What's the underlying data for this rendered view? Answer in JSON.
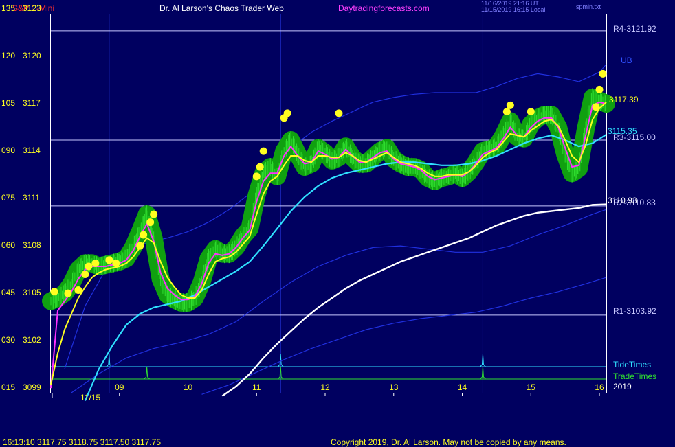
{
  "header": {
    "instrument": "S&P E-Mini",
    "site_title": "Dr. Al Larson's Chaos Trader Web",
    "website": "Daytradingforecasts.com",
    "stamp_utc": "11/16/2019 21:16 UT",
    "stamp_local": "11/15/2019 16:15 Local",
    "file_name": "spmin.txt"
  },
  "footer": {
    "quote": "16:13:10  3117.75  3118.75  3117.50  3117.75",
    "copyright": "Copyright 2019, Dr. Al Larson. May not be copied by any means."
  },
  "colors": {
    "background": "#000060",
    "price_halo": "#10a010",
    "price_bars": "#30e030",
    "magenta": "#ff30ff",
    "yellow": "#ffff20",
    "cyan": "#30e0ff",
    "white": "#ffffff",
    "blue_band": "#2030e0",
    "pivot_line": "#c8c8ff"
  },
  "chart_data": {
    "type": "line",
    "instrument": "S&P E-Mini",
    "y_axis_left_labels": [
      {
        "osc": "135",
        "price": "3123"
      },
      {
        "osc": "120",
        "price": "3120"
      },
      {
        "osc": "105",
        "price": "3117"
      },
      {
        "osc": "090",
        "price": "3114"
      },
      {
        "osc": "075",
        "price": "3111"
      },
      {
        "osc": "060",
        "price": "3108"
      },
      {
        "osc": "045",
        "price": "3105"
      },
      {
        "osc": "030",
        "price": "3102"
      },
      {
        "osc": "015",
        "price": "3099"
      }
    ],
    "ylim": [
      3099,
      3123
    ],
    "xlim": [
      8.0,
      16.1
    ],
    "x_ticks": [
      "09",
      "10",
      "11",
      "12",
      "13",
      "14",
      "15",
      "16"
    ],
    "x_tick_values": [
      9,
      10,
      11,
      12,
      13,
      14,
      15,
      16
    ],
    "date_label": "11/15",
    "year_label": "2019",
    "pivot_levels": [
      {
        "label": "R4-3121.92",
        "value": 3121.92
      },
      {
        "label": "R3-3115.00",
        "value": 3115.0
      },
      {
        "label": "R2-3110.83",
        "value": 3110.83
      },
      {
        "label": "R1-3103.92",
        "value": 3103.92
      }
    ],
    "value_labels": [
      {
        "label": "3117.39",
        "value": 3117.39,
        "color": "#ffff20"
      },
      {
        "label": "3115.35",
        "value": 3115.35,
        "color": "#30e0ff"
      },
      {
        "label": "3110.93",
        "value": 3110.93,
        "color": "#ffffff"
      }
    ],
    "band_label": "UB",
    "timing_lines": [
      {
        "name": "TideTimes",
        "spikes": [
          8.85,
          11.35,
          14.3
        ]
      },
      {
        "name": "TradeTimes",
        "spikes": [
          9.4,
          11.35,
          14.3
        ]
      }
    ],
    "vertical_markers": [
      8.85,
      11.35,
      14.3
    ],
    "series": [
      {
        "name": "price",
        "color": "#30e030",
        "x": [
          8.0,
          8.1,
          8.2,
          8.3,
          8.4,
          8.5,
          8.6,
          8.7,
          8.8,
          8.9,
          9.0,
          9.1,
          9.2,
          9.3,
          9.4,
          9.5,
          9.6,
          9.7,
          9.8,
          9.9,
          10.0,
          10.1,
          10.2,
          10.3,
          10.4,
          10.5,
          10.6,
          10.7,
          10.8,
          10.9,
          11.0,
          11.1,
          11.2,
          11.3,
          11.4,
          11.5,
          11.6,
          11.7,
          11.8,
          11.9,
          12.0,
          12.1,
          12.2,
          12.3,
          12.4,
          12.5,
          12.6,
          12.7,
          12.8,
          12.9,
          13.0,
          13.1,
          13.2,
          13.3,
          13.4,
          13.5,
          13.6,
          13.7,
          13.8,
          13.9,
          14.0,
          14.1,
          14.2,
          14.3,
          14.4,
          14.5,
          14.6,
          14.7,
          14.8,
          14.9,
          15.0,
          15.1,
          15.2,
          15.3,
          15.4,
          15.5,
          15.6,
          15.7,
          15.8,
          15.9,
          16.0,
          16.1
        ],
        "y": [
          3104.8,
          3105.0,
          3105.3,
          3105.9,
          3106.8,
          3107.2,
          3107.2,
          3107.0,
          3107.1,
          3107.2,
          3107.3,
          3107.5,
          3108.2,
          3109.2,
          3110.3,
          3108.8,
          3106.2,
          3105.2,
          3104.9,
          3104.7,
          3104.7,
          3105.0,
          3106.0,
          3107.5,
          3108.1,
          3107.8,
          3107.8,
          3108.2,
          3108.9,
          3109.4,
          3111.5,
          3112.9,
          3113.3,
          3112.7,
          3114.3,
          3115.0,
          3114.1,
          3113.3,
          3113.5,
          3114.5,
          3114.2,
          3113.7,
          3113.9,
          3114.6,
          3113.9,
          3113.5,
          3113.5,
          3113.9,
          3114.3,
          3114.5,
          3113.8,
          3113.5,
          3113.3,
          3113.3,
          3113.1,
          3112.6,
          3112.4,
          3112.6,
          3112.7,
          3112.9,
          3112.6,
          3113.0,
          3113.6,
          3114.3,
          3114.4,
          3114.6,
          3115.3,
          3116.2,
          3115.2,
          3115.1,
          3116.0,
          3116.4,
          3116.6,
          3116.6,
          3115.8,
          3114.1,
          3112.9,
          3113.2,
          3115.7,
          3117.7,
          3117.5,
          3117.3
        ]
      },
      {
        "name": "magenta",
        "color": "#ff30ff",
        "x": [
          8.0,
          8.1,
          8.2,
          8.3,
          8.4,
          8.5,
          8.6,
          8.7,
          8.8,
          8.9,
          9.0,
          9.1,
          9.2,
          9.3,
          9.4,
          9.5,
          9.6,
          9.7,
          9.8,
          9.9,
          10.0,
          10.1,
          10.2,
          10.3,
          10.4,
          10.5,
          10.6,
          10.7,
          10.8,
          10.9,
          11.0,
          11.1,
          11.2,
          11.3,
          11.4,
          11.5,
          11.6,
          11.7,
          11.8,
          11.9,
          12.0,
          12.1,
          12.2,
          12.3,
          12.4,
          12.5,
          12.6,
          12.7,
          12.8,
          12.9,
          13.0,
          13.1,
          13.2,
          13.3,
          13.4,
          13.5,
          13.6,
          13.7,
          13.8,
          13.9,
          14.0,
          14.1,
          14.2,
          14.3,
          14.4,
          14.5,
          14.6,
          14.7,
          14.8,
          14.9,
          15.0,
          15.1,
          15.2,
          15.3,
          15.4,
          15.5,
          15.6,
          15.7,
          15.8,
          15.9,
          16.0,
          16.1
        ],
        "y": [
          3099.3,
          3104.2,
          3104.8,
          3105.4,
          3106.2,
          3106.8,
          3107.0,
          3107.0,
          3107.0,
          3107.1,
          3107.2,
          3107.4,
          3108.0,
          3108.9,
          3109.7,
          3108.6,
          3106.6,
          3105.6,
          3105.2,
          3104.9,
          3104.9,
          3105.1,
          3105.9,
          3107.2,
          3107.8,
          3107.7,
          3107.8,
          3108.2,
          3108.8,
          3109.3,
          3111.1,
          3112.4,
          3112.9,
          3112.9,
          3114.0,
          3114.6,
          3114.0,
          3113.5,
          3113.6,
          3114.3,
          3114.1,
          3113.8,
          3113.9,
          3114.4,
          3114.0,
          3113.6,
          3113.6,
          3113.9,
          3114.2,
          3114.3,
          3113.8,
          3113.5,
          3113.4,
          3113.3,
          3113.1,
          3112.7,
          3112.5,
          3112.6,
          3112.7,
          3112.8,
          3112.7,
          3113.0,
          3113.5,
          3114.1,
          3114.3,
          3114.5,
          3115.1,
          3115.8,
          3115.3,
          3115.2,
          3115.8,
          3116.2,
          3116.4,
          3116.4,
          3115.8,
          3114.5,
          3113.3,
          3113.4,
          3115.3,
          3117.2,
          3117.4,
          3117.3
        ]
      },
      {
        "name": "yellow",
        "color": "#ffff20",
        "x": [
          8.0,
          8.1,
          8.2,
          8.3,
          8.4,
          8.5,
          8.6,
          8.7,
          8.8,
          8.9,
          9.0,
          9.1,
          9.2,
          9.3,
          9.4,
          9.5,
          9.6,
          9.7,
          9.8,
          9.9,
          10.0,
          10.1,
          10.2,
          10.3,
          10.4,
          10.5,
          10.6,
          10.7,
          10.8,
          10.9,
          11.0,
          11.1,
          11.2,
          11.3,
          11.4,
          11.5,
          11.6,
          11.7,
          11.8,
          11.9,
          12.0,
          12.1,
          12.2,
          12.3,
          12.4,
          12.5,
          12.6,
          12.7,
          12.8,
          12.9,
          13.0,
          13.1,
          13.2,
          13.3,
          13.4,
          13.5,
          13.6,
          13.7,
          13.8,
          13.9,
          14.0,
          14.1,
          14.2,
          14.3,
          14.4,
          14.5,
          14.6,
          14.7,
          14.8,
          14.9,
          15.0,
          15.1,
          15.2,
          15.3,
          15.4,
          15.5,
          15.6,
          15.7,
          15.8,
          15.9,
          16.0,
          16.1
        ],
        "y": [
          3099.5,
          3101.5,
          3103.0,
          3104.0,
          3105.0,
          3105.7,
          3106.3,
          3106.6,
          3106.8,
          3106.9,
          3107.0,
          3107.2,
          3107.6,
          3108.2,
          3108.8,
          3108.5,
          3107.3,
          3106.3,
          3105.7,
          3105.2,
          3105.0,
          3105.0,
          3105.5,
          3106.5,
          3107.3,
          3107.5,
          3107.6,
          3107.9,
          3108.4,
          3108.9,
          3110.3,
          3111.6,
          3112.4,
          3112.7,
          3113.4,
          3114.0,
          3114.0,
          3113.7,
          3113.6,
          3114.0,
          3114.0,
          3113.9,
          3113.9,
          3114.2,
          3114.0,
          3113.7,
          3113.6,
          3113.8,
          3114.0,
          3114.2,
          3113.9,
          3113.6,
          3113.5,
          3113.4,
          3113.2,
          3112.9,
          3112.7,
          3112.7,
          3112.8,
          3112.8,
          3112.8,
          3113.0,
          3113.4,
          3113.9,
          3114.2,
          3114.4,
          3114.9,
          3115.4,
          3115.3,
          3115.2,
          3115.6,
          3115.9,
          3116.2,
          3116.3,
          3115.9,
          3115.0,
          3114.0,
          3113.6,
          3114.7,
          3116.3,
          3117.0,
          3117.4
        ]
      },
      {
        "name": "cyan",
        "color": "#30e0ff",
        "x": [
          8.5,
          8.7,
          8.9,
          9.1,
          9.3,
          9.5,
          9.7,
          9.9,
          10.1,
          10.3,
          10.5,
          10.7,
          10.9,
          11.1,
          11.3,
          11.5,
          11.7,
          11.9,
          12.1,
          12.3,
          12.5,
          12.7,
          12.9,
          13.1,
          13.3,
          13.5,
          13.7,
          13.9,
          14.1,
          14.3,
          14.5,
          14.7,
          14.9,
          15.1,
          15.3,
          15.5,
          15.7,
          15.9,
          16.1
        ],
        "y": [
          3098.5,
          3100.5,
          3102.0,
          3103.3,
          3104.0,
          3104.4,
          3104.6,
          3104.8,
          3105.2,
          3105.7,
          3106.2,
          3106.7,
          3107.3,
          3108.3,
          3109.4,
          3110.5,
          3111.4,
          3112.1,
          3112.6,
          3112.9,
          3113.1,
          3113.3,
          3113.5,
          3113.6,
          3113.6,
          3113.5,
          3113.4,
          3113.4,
          3113.5,
          3113.7,
          3114.0,
          3114.4,
          3114.8,
          3115.1,
          3115.3,
          3115.0,
          3114.6,
          3114.8,
          3115.35
        ]
      },
      {
        "name": "white",
        "color": "#ffffff",
        "x": [
          10.5,
          10.7,
          10.9,
          11.1,
          11.3,
          11.5,
          11.7,
          11.9,
          12.1,
          12.3,
          12.5,
          12.7,
          12.9,
          13.1,
          13.3,
          13.5,
          13.7,
          13.9,
          14.1,
          14.3,
          14.5,
          14.7,
          14.9,
          15.1,
          15.3,
          15.5,
          15.7,
          15.9,
          16.1
        ],
        "y": [
          3098.8,
          3099.4,
          3100.2,
          3101.2,
          3102.1,
          3102.9,
          3103.7,
          3104.4,
          3105.0,
          3105.6,
          3106.1,
          3106.5,
          3106.9,
          3107.3,
          3107.6,
          3107.9,
          3108.2,
          3108.5,
          3108.8,
          3109.2,
          3109.6,
          3109.9,
          3110.2,
          3110.4,
          3110.5,
          3110.6,
          3110.7,
          3110.9,
          3110.93
        ]
      },
      {
        "name": "upper band",
        "color": "#2030e0",
        "x": [
          8.2,
          8.5,
          8.8,
          9.1,
          9.4,
          9.7,
          10.0,
          10.3,
          10.6,
          10.9,
          11.2,
          11.5,
          11.8,
          12.1,
          12.4,
          12.7,
          13.0,
          13.3,
          13.6,
          13.9,
          14.2,
          14.5,
          14.8,
          15.1,
          15.4,
          15.7,
          16.0,
          16.1
        ],
        "y": [
          3100.5,
          3104.5,
          3106.8,
          3108.0,
          3108.5,
          3108.8,
          3109.2,
          3109.8,
          3110.6,
          3111.6,
          3113.2,
          3114.5,
          3115.5,
          3116.2,
          3116.8,
          3117.4,
          3117.7,
          3117.9,
          3118.0,
          3118.0,
          3118.0,
          3118.4,
          3118.9,
          3119.2,
          3119.0,
          3118.7,
          3119.3,
          3119.8
        ]
      },
      {
        "name": "lower band",
        "color": "#2030e0",
        "x": [
          8.3,
          8.7,
          9.1,
          9.5,
          9.9,
          10.3,
          10.7,
          11.1,
          11.5,
          11.9,
          12.3,
          12.7,
          13.1,
          13.5,
          13.9,
          14.3,
          14.7,
          15.1,
          15.5,
          15.9,
          16.1
        ],
        "y": [
          3099.0,
          3100.2,
          3101.2,
          3101.8,
          3102.2,
          3102.7,
          3103.5,
          3104.8,
          3106.0,
          3107.0,
          3107.7,
          3108.2,
          3108.3,
          3108.1,
          3107.9,
          3107.9,
          3108.3,
          3109.0,
          3109.6,
          3110.3,
          3110.6
        ]
      },
      {
        "name": "lower band 2",
        "color": "#2030e0",
        "x": [
          10.2,
          10.6,
          11.0,
          11.4,
          11.8,
          12.2,
          12.6,
          13.0,
          13.4,
          13.8,
          14.2,
          14.6,
          15.0,
          15.4,
          15.8,
          16.1
        ],
        "y": [
          3098.9,
          3099.5,
          3100.3,
          3101.1,
          3101.8,
          3102.4,
          3103.0,
          3103.4,
          3103.7,
          3103.9,
          3104.1,
          3104.5,
          3105.0,
          3105.4,
          3105.9,
          3106.3
        ]
      }
    ],
    "yellow_dots": [
      {
        "x": 8.05,
        "y": 3105.4
      },
      {
        "x": 8.25,
        "y": 3105.3
      },
      {
        "x": 8.4,
        "y": 3105.5
      },
      {
        "x": 8.5,
        "y": 3106.5
      },
      {
        "x": 8.55,
        "y": 3107.0
      },
      {
        "x": 8.65,
        "y": 3107.2
      },
      {
        "x": 8.85,
        "y": 3107.4
      },
      {
        "x": 8.95,
        "y": 3107.2
      },
      {
        "x": 9.3,
        "y": 3108.3
      },
      {
        "x": 9.35,
        "y": 3109.0
      },
      {
        "x": 9.45,
        "y": 3109.8
      },
      {
        "x": 9.5,
        "y": 3110.3
      },
      {
        "x": 11.0,
        "y": 3112.7
      },
      {
        "x": 11.05,
        "y": 3113.3
      },
      {
        "x": 11.1,
        "y": 3114.3
      },
      {
        "x": 11.4,
        "y": 3116.4
      },
      {
        "x": 11.45,
        "y": 3116.7
      },
      {
        "x": 12.2,
        "y": 3116.7
      },
      {
        "x": 14.65,
        "y": 3116.8
      },
      {
        "x": 14.7,
        "y": 3117.2
      },
      {
        "x": 15.0,
        "y": 3116.8
      },
      {
        "x": 15.95,
        "y": 3117.1
      },
      {
        "x": 16.0,
        "y": 3118.2
      },
      {
        "x": 16.05,
        "y": 3119.2
      }
    ]
  }
}
